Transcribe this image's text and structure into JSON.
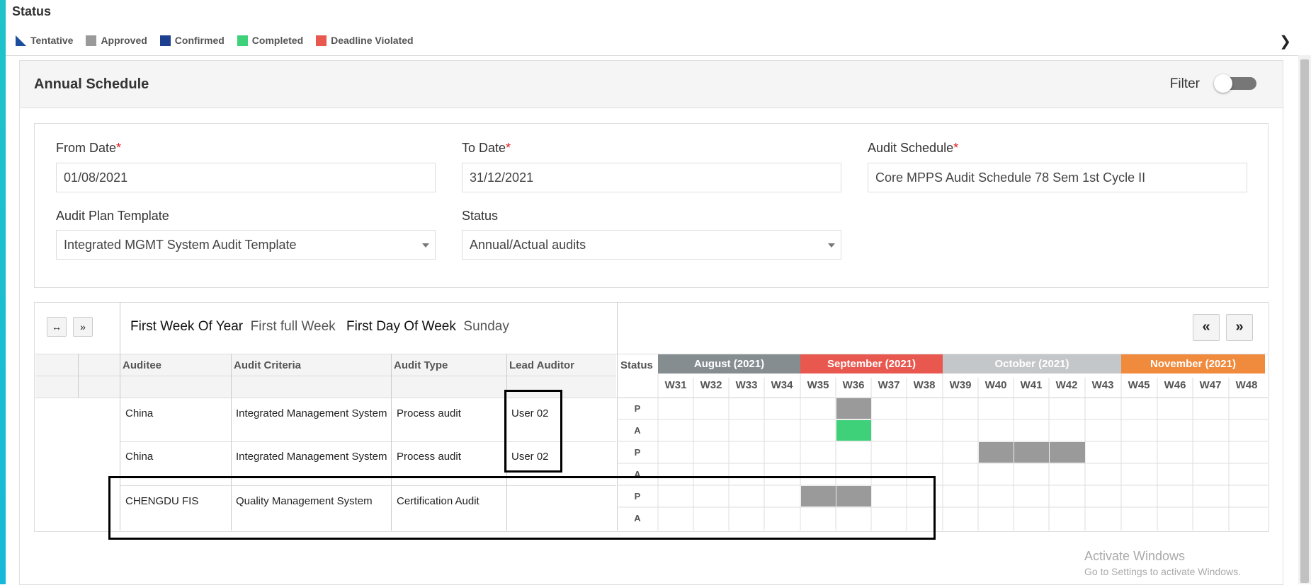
{
  "status": {
    "title": "Status",
    "legend": [
      {
        "label": "Tentative",
        "color": "#1d4e9e",
        "icon": "triangle-swatch-icon"
      },
      {
        "label": "Approved",
        "color": "#9a9a9a"
      },
      {
        "label": "Confirmed",
        "color": "#1d3f8f"
      },
      {
        "label": "Completed",
        "color": "#3fd07a"
      },
      {
        "label": "Deadline Violated",
        "color": "#e8584f"
      }
    ]
  },
  "card": {
    "title": "Annual Schedule",
    "filter_label": "Filter"
  },
  "form": {
    "from_date": {
      "label": "From Date",
      "required": "*",
      "value": "01/08/2021"
    },
    "to_date": {
      "label": "To Date",
      "required": "*",
      "value": "31/12/2021"
    },
    "audit_schedule": {
      "label": "Audit Schedule",
      "required": "*",
      "value": "Core MPPS Audit Schedule 78 Sem 1st Cycle II"
    },
    "audit_plan_template": {
      "label": "Audit Plan Template",
      "value": "Integrated MGMT System Audit Template"
    },
    "status": {
      "label": "Status",
      "value": "Annual/Actual audits"
    }
  },
  "grid": {
    "expand_btn": "↔",
    "next_btn": "»",
    "first_week_label": "First Week Of Year",
    "first_week_value": "First full Week",
    "first_day_label": "First Day Of Week",
    "first_day_value": "Sunday",
    "prev_nav": "«",
    "next_nav": "»",
    "columns": [
      "Auditee",
      "Audit Criteria",
      "Audit Type",
      "Lead Auditor"
    ],
    "status_col": "Status",
    "rows": [
      {
        "auditee": "China",
        "criteria": "Integrated Management System",
        "type": "Process audit",
        "lead": "User 02"
      },
      {
        "auditee": "China",
        "criteria": "Integrated Management System",
        "type": "Process audit",
        "lead": "User 02"
      },
      {
        "auditee": "CHENGDU FIS",
        "criteria": "Quality Management System",
        "type": "Certification Audit",
        "lead": ""
      }
    ],
    "pa": [
      "P",
      "A",
      "P",
      "A",
      "P",
      "A"
    ],
    "months": [
      {
        "label": "August (2021)",
        "color": "#858d91"
      },
      {
        "label": "September (2021)",
        "color": "#e8584f"
      },
      {
        "label": "October (2021)",
        "color": "#c3c7ca"
      },
      {
        "label": "November (2021)",
        "color": "#f08a3c"
      }
    ],
    "weeks": [
      "W31",
      "W32",
      "W33",
      "W34",
      "W35",
      "W36",
      "W37",
      "W38",
      "W39",
      "W40",
      "W41",
      "W42",
      "W43",
      "W45",
      "W46",
      "W47",
      "W48"
    ]
  },
  "watermark": {
    "line1": "Activate Windows",
    "line2": "Go to Settings to activate Windows."
  }
}
